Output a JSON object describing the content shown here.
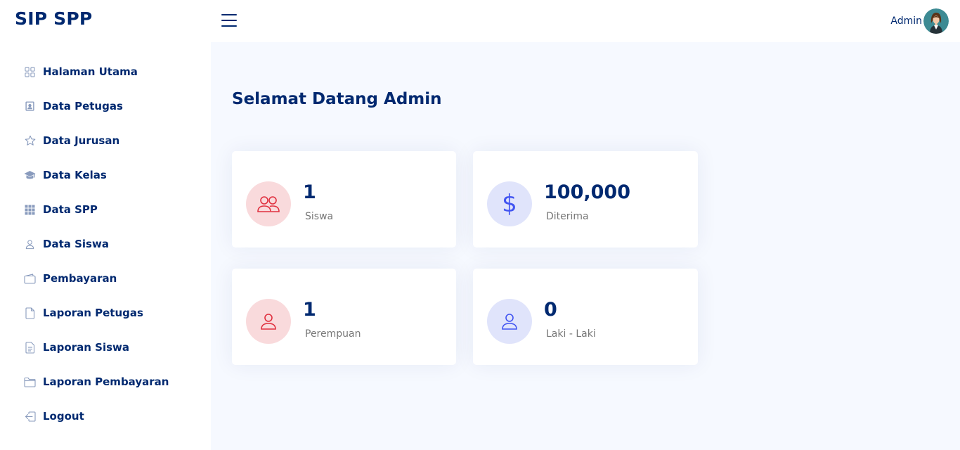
{
  "header": {
    "brand": "SIP SPP",
    "menu_icon": "hamburger-icon",
    "user_name": "Admin",
    "avatar_icon": "user-avatar"
  },
  "sidebar": {
    "items": [
      {
        "label": "Halaman Utama",
        "icon": "grid-icon"
      },
      {
        "label": "Data Petugas",
        "icon": "person-badge-icon"
      },
      {
        "label": "Data Jurusan",
        "icon": "star-icon"
      },
      {
        "label": "Data Kelas",
        "icon": "mortarboard-icon"
      },
      {
        "label": "Data SPP",
        "icon": "grid-3x3-icon"
      },
      {
        "label": "Data Siswa",
        "icon": "person-icon"
      },
      {
        "label": "Pembayaran",
        "icon": "wallet-icon"
      },
      {
        "label": "Laporan Petugas",
        "icon": "file-icon"
      },
      {
        "label": "Laporan Siswa",
        "icon": "file-text-icon"
      },
      {
        "label": "Laporan Pembayaran",
        "icon": "folder-icon"
      },
      {
        "label": "Logout",
        "icon": "box-arrow-left-icon"
      }
    ]
  },
  "main": {
    "title": "Selamat Datang Admin",
    "cards": [
      {
        "value": "1",
        "label": "Siswa",
        "icon": "people-icon",
        "icon_color": "#e0303f",
        "icon_bg": "#f9dadc"
      },
      {
        "value": "100,000",
        "label": "Diterima",
        "icon": "dollar-icon",
        "icon_color": "#4154f1",
        "icon_bg": "#e0e4fb"
      },
      {
        "value": "1",
        "label": "Perempuan",
        "icon": "person-icon",
        "icon_color": "#e0303f",
        "icon_bg": "#f9dadc"
      },
      {
        "value": "0",
        "label": "Laki - Laki",
        "icon": "person-icon",
        "icon_color": "#4154f1",
        "icon_bg": "#e0e4fb"
      }
    ]
  },
  "colors": {
    "primary": "#012970",
    "background": "#f6f9ff",
    "muted_text": "#777777"
  }
}
